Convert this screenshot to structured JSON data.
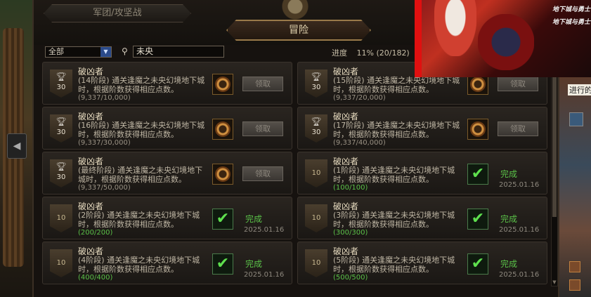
{
  "tabs": {
    "legion": "军团/攻坚战",
    "adventure": "冒险"
  },
  "filter": {
    "category": "全部",
    "search_value": "未央"
  },
  "progress": {
    "label": "进度",
    "value": "11% (20/182)"
  },
  "cards": [
    {
      "title": "破凶者",
      "desc": "(14阶段) 通关逢魔之未央幻境地下城时，根据阶数获得相应点数。",
      "progress": "(9,337/10,000)",
      "points": "30",
      "claim": "领取",
      "done": false
    },
    {
      "title": "破凶者",
      "desc": "(15阶段) 通关逢魔之未央幻境地下城时，根据阶数获得相应点数。",
      "progress": "(9,337/20,000)",
      "points": "30",
      "claim": "领取",
      "done": false
    },
    {
      "title": "破凶者",
      "desc": "(16阶段) 通关逢魔之未央幻境地下城时，根据阶数获得相应点数。",
      "progress": "(9,337/30,000)",
      "points": "30",
      "claim": "领取",
      "done": false
    },
    {
      "title": "破凶者",
      "desc": "(17阶段) 通关逢魔之未央幻境地下城时，根据阶数获得相应点数。",
      "progress": "(9,337/40,000)",
      "points": "30",
      "claim": "领取",
      "done": false
    },
    {
      "title": "破凶者",
      "desc": "(最终阶段) 通关逢魔之未央幻境地下城时，根据阶数获得相应点数。",
      "progress": "(9,337/50,000)",
      "points": "30",
      "claim": "领取",
      "done": false
    },
    {
      "title": "破凶者",
      "desc": "(1阶段) 通关逢魔之未央幻境地下城时，根据阶数获得相应点数。",
      "progress": "(100/100)",
      "points": "10",
      "status": "完成",
      "date": "2025.01.16",
      "done": true
    },
    {
      "title": "破凶者",
      "desc": "(2阶段) 通关逢魔之未央幻境地下城时，根据阶数获得相应点数。",
      "progress": "(200/200)",
      "points": "10",
      "status": "完成",
      "date": "2025.01.16",
      "done": true
    },
    {
      "title": "破凶者",
      "desc": "(3阶段) 通关逢魔之未央幻境地下城时，根据阶数获得相应点数。",
      "progress": "(300/300)",
      "points": "10",
      "status": "完成",
      "date": "2025.01.16",
      "done": true
    },
    {
      "title": "破凶者",
      "desc": "(4阶段) 通关逢魔之未央幻境地下城时，根据阶数获得相应点数。",
      "progress": "(400/400)",
      "points": "10",
      "status": "完成",
      "date": "2025.01.16",
      "done": true
    },
    {
      "title": "破凶者",
      "desc": "(5阶段) 通关逢魔之未央幻境地下城时，根据阶数获得相应点数。",
      "progress": "(500/500)",
      "points": "10",
      "status": "完成",
      "date": "2025.01.16",
      "done": true
    }
  ],
  "side": {
    "text": "进行的"
  },
  "banner": {
    "logo": "地下城与勇士"
  },
  "colors": {
    "complete": "#5ac048",
    "accent": "#9a7a4a"
  }
}
